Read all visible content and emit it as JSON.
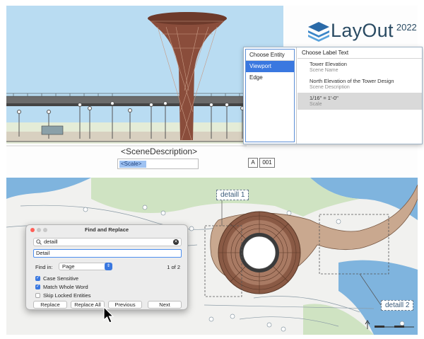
{
  "brand": {
    "name": "LayOut",
    "year": "2022",
    "logo_icon": "layout-stack-logo-icon",
    "color": "#2a4b63"
  },
  "label_popup": {
    "entity_header": "Choose Entity",
    "entities": [
      {
        "label": "Viewport",
        "selected": true
      },
      {
        "label": "Edge",
        "selected": false
      }
    ],
    "text_header": "Choose Label Text",
    "options": [
      {
        "value": "Tower Elevation",
        "kind": "Scene Name",
        "selected": false
      },
      {
        "value": "North Elevation of the Tower Design",
        "kind": "Scene Description",
        "selected": false
      },
      {
        "value": "1/16\" = 1'-0\"",
        "kind": "Scale",
        "selected": true
      }
    ]
  },
  "viewport_labels": {
    "scene_description_tag": "<SceneDescription>",
    "scale_tag": "<Scale>",
    "page_letter": "A",
    "page_number": "001"
  },
  "detail_labels": [
    "detaill 1",
    "detaill 2"
  ],
  "find_replace": {
    "title": "Find and Replace",
    "search_value": "detaill",
    "replace_value": "Detail",
    "find_in_label": "Find in:",
    "find_in_value": "Page",
    "match_count": "1 of 2",
    "options": [
      {
        "label": "Case Sensitive",
        "checked": true
      },
      {
        "label": "Match Whole Word",
        "checked": true
      },
      {
        "label": "Skip Locked Entities",
        "checked": false
      }
    ],
    "buttons": {
      "replace": "Replace",
      "replace_all": "Replace All",
      "previous": "Previous",
      "next": "Next"
    }
  },
  "colors": {
    "accent": "#3a78e0",
    "sky": "#b9dcf2",
    "water": "#7fb4de",
    "tower": "#8a4d3b",
    "ground_tan": "#c9a88f"
  }
}
